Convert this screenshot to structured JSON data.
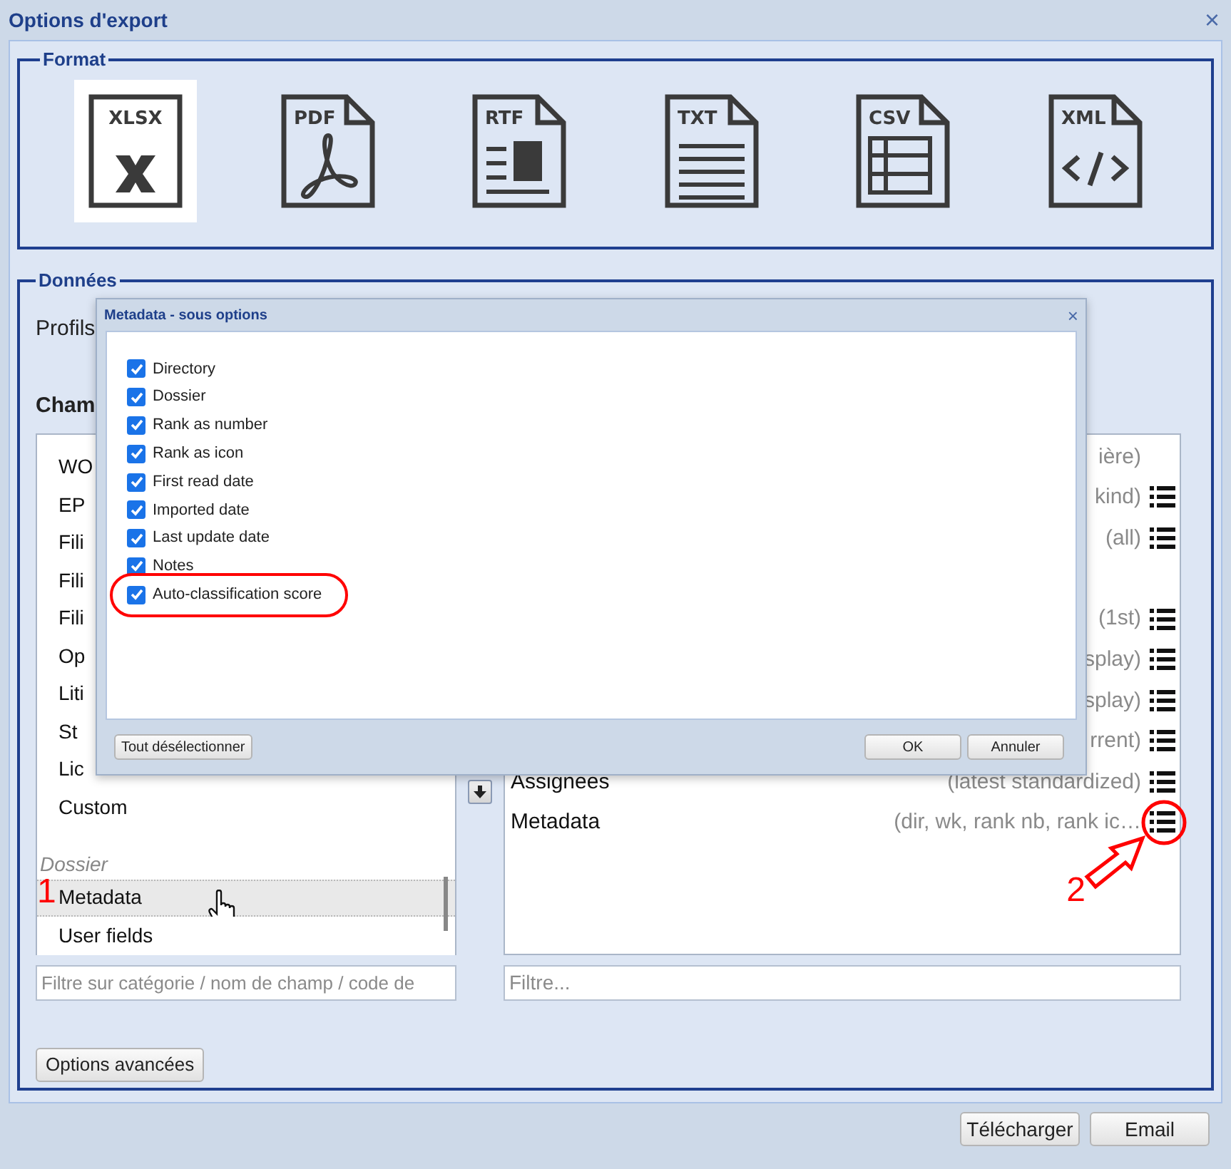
{
  "window": {
    "title": "Options d'export"
  },
  "format": {
    "legend": "Format",
    "options": [
      {
        "label": "XLSX",
        "kind": "xlsx",
        "selected": true
      },
      {
        "label": "PDF",
        "kind": "pdf",
        "selected": false
      },
      {
        "label": "RTF",
        "kind": "rtf",
        "selected": false
      },
      {
        "label": "TXT",
        "kind": "txt",
        "selected": false
      },
      {
        "label": "CSV",
        "kind": "csv",
        "selected": false
      },
      {
        "label": "XML",
        "kind": "xml",
        "selected": false
      }
    ]
  },
  "data": {
    "legend": "Données",
    "profiles_label": "Profils",
    "fields_heading": "Cham",
    "available_fields": [
      {
        "kind": "field",
        "label": "WO",
        "selected": false
      },
      {
        "kind": "field",
        "label": "EP",
        "selected": false
      },
      {
        "kind": "field",
        "label": "Fili",
        "selected": false
      },
      {
        "kind": "field",
        "label": "Fili",
        "selected": false
      },
      {
        "kind": "field",
        "label": "Fili",
        "selected": false
      },
      {
        "kind": "field",
        "label": "Op",
        "selected": false
      },
      {
        "kind": "field",
        "label": "Liti",
        "selected": false
      },
      {
        "kind": "field",
        "label": "St",
        "selected": false
      },
      {
        "kind": "field",
        "label": "Lic",
        "selected": false
      },
      {
        "kind": "field",
        "label": "Custom",
        "selected": false
      },
      {
        "kind": "category",
        "label": "Dossier"
      },
      {
        "kind": "field",
        "label": "Metadata",
        "selected": true,
        "step": "1"
      },
      {
        "kind": "field",
        "label": "User fields",
        "selected": false
      }
    ],
    "selected_fields": [
      {
        "detail": "ière)",
        "options": false
      },
      {
        "detail": "kind)",
        "options": true
      },
      {
        "detail": "(all)",
        "options": true
      },
      {
        "detail": "(1st)",
        "options": true
      },
      {
        "detail": "splay)",
        "options": true
      },
      {
        "detail": "splay)",
        "options": true
      },
      {
        "detail": "rrent)",
        "options": true
      },
      {
        "name": "Assignees",
        "detail": "(latest standardized)",
        "options": true
      },
      {
        "name": "Metadata",
        "detail": "(dir, wk, rank nb, rank ic…",
        "options": true,
        "step": "2"
      }
    ],
    "left_filter": {
      "placeholder": "Filtre sur catégorie / nom de champ / code de"
    },
    "right_filter": {
      "placeholder": "Filtre..."
    },
    "advanced_button": "Options avancées"
  },
  "dialog": {
    "title": "Metadata - sous options",
    "close": "×",
    "options": [
      {
        "label": "Directory",
        "checked": true,
        "highlighted": false
      },
      {
        "label": "Dossier",
        "checked": true,
        "highlighted": false
      },
      {
        "label": "Rank as number",
        "checked": true,
        "highlighted": false
      },
      {
        "label": "Rank as icon",
        "checked": true,
        "highlighted": false
      },
      {
        "label": "First read date",
        "checked": true,
        "highlighted": false
      },
      {
        "label": "Imported date",
        "checked": true,
        "highlighted": false
      },
      {
        "label": "Last update date",
        "checked": true,
        "highlighted": false
      },
      {
        "label": "Notes",
        "checked": true,
        "highlighted": false
      },
      {
        "label": "Auto-classification score",
        "checked": true,
        "highlighted": true
      }
    ],
    "deselect_all": "Tout désélectionner",
    "ok": "OK",
    "cancel": "Annuler"
  },
  "footer": {
    "buttons": [
      "Télécharger",
      "Email"
    ]
  },
  "close": "×"
}
